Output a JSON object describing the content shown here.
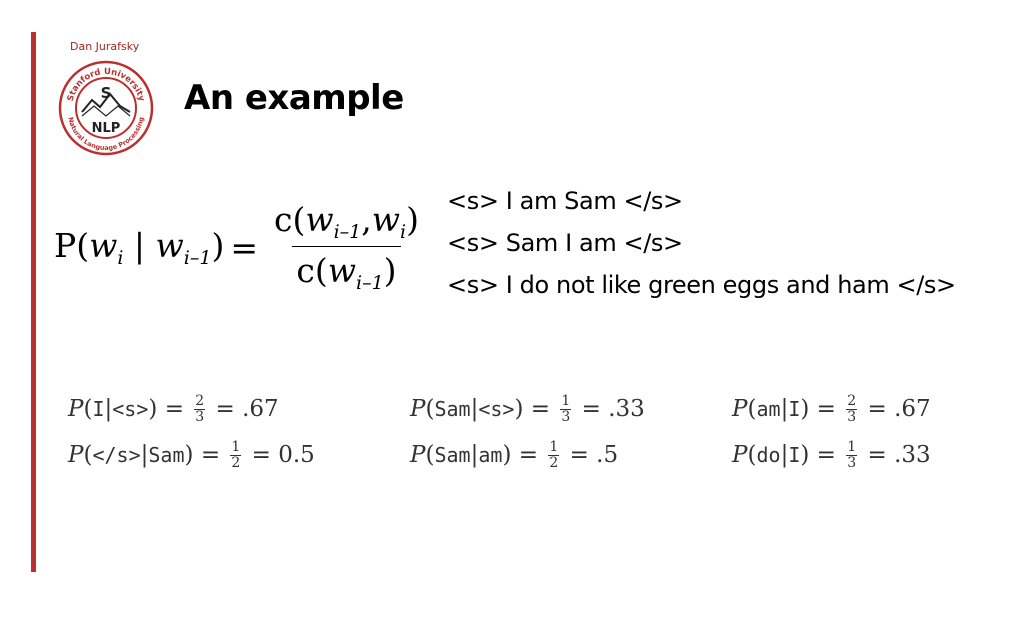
{
  "header": {
    "author": "Dan Jurafsky",
    "title": "An example",
    "logo": {
      "top_text": "Stanford University",
      "bottom_text": "Natural Language Processing",
      "center_letter": "S",
      "nlp": "NLP",
      "color": "#b8312f"
    }
  },
  "formula": {
    "lhs_P": "P(",
    "lhs_w1": "w",
    "lhs_sub1": "i",
    "lhs_bar": " | ",
    "lhs_w2": "w",
    "lhs_sub2": "i–1",
    "lhs_close": ")",
    "equals": "=",
    "num_c": "c(",
    "num_w1": "w",
    "num_sub1": "i–1",
    "num_comma": ",",
    "num_w2": "w",
    "num_sub2": "i",
    "num_close": ")",
    "den_c": "c(",
    "den_w": "w",
    "den_sub": "i–1",
    "den_close": ")"
  },
  "sentences": [
    "<s> I am Sam </s>",
    "<s> Sam I am </s>",
    "<s> I do not like green eggs and ham </s>"
  ],
  "probabilities": [
    [
      {
        "P": "P",
        "arg": "I",
        "cond": "<s>",
        "eq1": "=",
        "num": "2",
        "den": "3",
        "eq2": "=",
        "val": ".67"
      },
      {
        "P": "P",
        "arg": "Sam",
        "cond": "<s>",
        "eq1": "=",
        "num": "1",
        "den": "3",
        "eq2": "=",
        "val": ".33"
      },
      {
        "P": "P",
        "arg": "am",
        "cond": "I",
        "eq1": "=",
        "num": "2",
        "den": "3",
        "eq2": "=",
        "val": ".67"
      }
    ],
    [
      {
        "P": "P",
        "arg": "</s>",
        "cond": "Sam",
        "eq1": "=",
        "num": "1",
        "den": "2",
        "eq2": "=",
        "val": "0.5"
      },
      {
        "P": "P",
        "arg": "Sam",
        "cond": "am",
        "eq1": "=",
        "num": "1",
        "den": "2",
        "eq2": "=",
        "val": ".5"
      },
      {
        "P": "P",
        "arg": "do",
        "cond": "I",
        "eq1": "=",
        "num": "1",
        "den": "3",
        "eq2": "=",
        "val": ".33"
      }
    ]
  ]
}
